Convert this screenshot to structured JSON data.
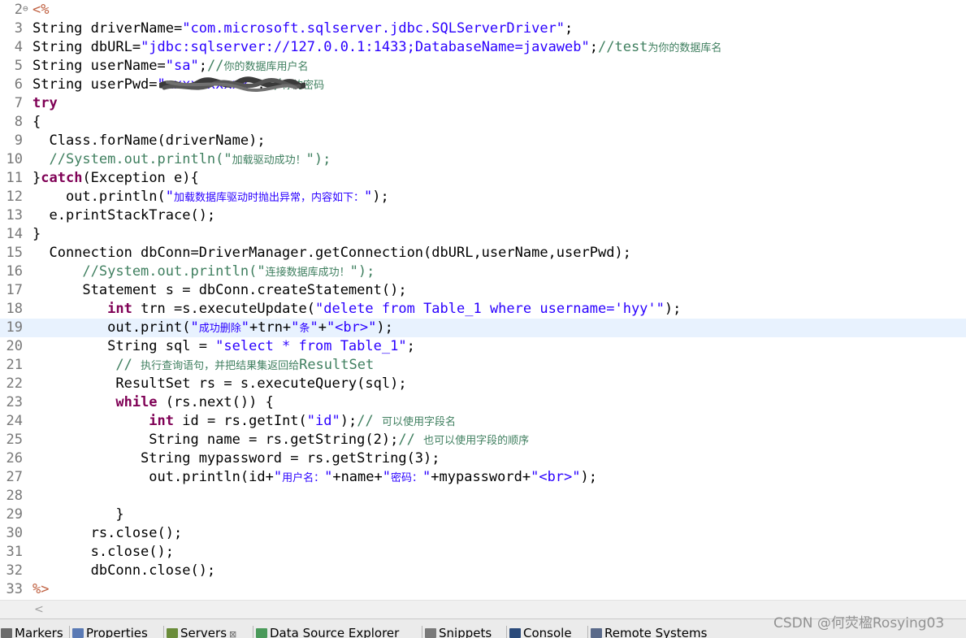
{
  "editor": {
    "lines": [
      {
        "n": "2",
        "fold": "⊖",
        "parts": [
          [
            "jsp",
            "<%"
          ]
        ]
      },
      {
        "n": "3",
        "parts": [
          [
            "",
            "String driverName="
          ],
          [
            "str",
            "\"com.microsoft.sqlserver.jdbc.SQLServerDriver\""
          ],
          [
            "",
            ";"
          ]
        ]
      },
      {
        "n": "4",
        "parts": [
          [
            "",
            "String dbURL="
          ],
          [
            "str",
            "\"jdbc:sqlserver://127.0.0.1:1433;DatabaseName=javaweb\""
          ],
          [
            "",
            ";"
          ],
          [
            "cm",
            "//test"
          ],
          [
            "cm cn",
            "为你的数据库名"
          ]
        ]
      },
      {
        "n": "5",
        "parts": [
          [
            "",
            "String userName="
          ],
          [
            "str",
            "\"sa\""
          ],
          [
            "",
            ";"
          ],
          [
            "cm",
            "//"
          ],
          [
            "cm cn",
            "你的数据库用户名"
          ]
        ]
      },
      {
        "n": "6",
        "parts": [
          [
            "",
            "String userPwd="
          ],
          [
            "str",
            "\"xxxxxxxxxx\""
          ],
          [
            "",
            ";"
          ],
          [
            "cm",
            "//"
          ],
          [
            "cm cn",
            "你的密码"
          ]
        ]
      },
      {
        "n": "7",
        "parts": [
          [
            "kw",
            "try"
          ]
        ]
      },
      {
        "n": "8",
        "parts": [
          [
            "",
            "{"
          ]
        ]
      },
      {
        "n": "9",
        "parts": [
          [
            "",
            "  Class.forName(driverName);"
          ]
        ]
      },
      {
        "n": "10",
        "parts": [
          [
            "cm",
            "  //System.out.println(\""
          ],
          [
            "cm cn",
            "加载驱动成功！"
          ],
          [
            "cm",
            "\");"
          ]
        ]
      },
      {
        "n": "11",
        "parts": [
          [
            "",
            "}"
          ],
          [
            "kw",
            "catch"
          ],
          [
            "",
            "(Exception e){"
          ]
        ]
      },
      {
        "n": "12",
        "parts": [
          [
            "",
            "    out.println("
          ],
          [
            "str",
            "\""
          ],
          [
            "str cn",
            "加载数据库驱动时抛出异常，内容如下："
          ],
          [
            "str",
            "\""
          ],
          [
            "",
            ");"
          ]
        ]
      },
      {
        "n": "13",
        "parts": [
          [
            "",
            "  e.printStackTrace();"
          ]
        ]
      },
      {
        "n": "14",
        "parts": [
          [
            "",
            "}"
          ]
        ]
      },
      {
        "n": "15",
        "parts": [
          [
            "",
            "  Connection dbConn=DriverManager.getConnection(dbURL,userName,userPwd);"
          ]
        ]
      },
      {
        "n": "16",
        "parts": [
          [
            "cm",
            "      //System.out.println(\""
          ],
          [
            "cm cn",
            "连接数据库成功！"
          ],
          [
            "cm",
            "\");"
          ]
        ]
      },
      {
        "n": "17",
        "parts": [
          [
            "",
            "      Statement s = dbConn.createStatement();"
          ]
        ]
      },
      {
        "n": "18",
        "parts": [
          [
            "",
            "         "
          ],
          [
            "kw",
            "int"
          ],
          [
            "",
            " trn =s.executeUpdate("
          ],
          [
            "str",
            "\"delete from Table_1 where username='hyy'\""
          ],
          [
            "",
            ");"
          ]
        ]
      },
      {
        "n": "19",
        "current": true,
        "parts": [
          [
            "",
            "         out.print("
          ],
          [
            "str",
            "\""
          ],
          [
            "str cn",
            "成功删除"
          ],
          [
            "str",
            "\""
          ],
          [
            "",
            "+trn+"
          ],
          [
            "str",
            "\""
          ],
          [
            "str cn",
            "条"
          ],
          [
            "str",
            "\""
          ],
          [
            "",
            "+"
          ],
          [
            "str",
            "\"<br>\""
          ],
          [
            "",
            ");"
          ]
        ]
      },
      {
        "n": "20",
        "parts": [
          [
            "",
            "         String sql = "
          ],
          [
            "str",
            "\"select * from Table_1\""
          ],
          [
            "",
            ";"
          ]
        ]
      },
      {
        "n": "21",
        "parts": [
          [
            "cm",
            "          // "
          ],
          [
            "cm cn",
            "执行查询语句，并把结果集返回给"
          ],
          [
            "cm",
            "ResultSet"
          ]
        ]
      },
      {
        "n": "22",
        "parts": [
          [
            "",
            "          ResultSet rs = s.executeQuery(sql);"
          ]
        ]
      },
      {
        "n": "23",
        "parts": [
          [
            "",
            "          "
          ],
          [
            "kw",
            "while"
          ],
          [
            "",
            " (rs.next()) {"
          ]
        ]
      },
      {
        "n": "24",
        "parts": [
          [
            "",
            "              "
          ],
          [
            "kw",
            "int"
          ],
          [
            "",
            " id = rs.getInt("
          ],
          [
            "str",
            "\"id\""
          ],
          [
            "",
            ");"
          ],
          [
            "cm",
            "// "
          ],
          [
            "cm cn",
            "可以使用字段名"
          ]
        ]
      },
      {
        "n": "25",
        "parts": [
          [
            "",
            "              String name = rs.getString(2);"
          ],
          [
            "cm",
            "// "
          ],
          [
            "cm cn",
            "也可以使用字段的顺序"
          ]
        ]
      },
      {
        "n": "26",
        "parts": [
          [
            "",
            "             String mypassword = rs.getString(3);"
          ]
        ]
      },
      {
        "n": "27",
        "parts": [
          [
            "",
            "              out.println(id+"
          ],
          [
            "str",
            "\""
          ],
          [
            "str cn",
            "用户名："
          ],
          [
            "str",
            "\""
          ],
          [
            "",
            "+name+"
          ],
          [
            "str",
            "\""
          ],
          [
            "str cn",
            "密码："
          ],
          [
            "str",
            "\""
          ],
          [
            "",
            "+mypassword+"
          ],
          [
            "str",
            "\"<br>\""
          ],
          [
            "",
            ");"
          ]
        ]
      },
      {
        "n": "28",
        "parts": []
      },
      {
        "n": "29",
        "parts": [
          [
            "",
            "          }"
          ]
        ]
      },
      {
        "n": "30",
        "parts": [
          [
            "",
            "       rs.close();"
          ]
        ]
      },
      {
        "n": "31",
        "parts": [
          [
            "",
            "       s.close();"
          ]
        ]
      },
      {
        "n": "32",
        "parts": [
          [
            "",
            "       dbConn.close();"
          ]
        ]
      },
      {
        "n": "33",
        "parts": [
          [
            "jsp",
            "%>"
          ]
        ]
      }
    ]
  },
  "scrollbar": {
    "left_arrow": "<"
  },
  "tabs": [
    {
      "label": "Markers",
      "icon": "markers-icon",
      "color": "#6b6b6b"
    },
    {
      "label": "Properties",
      "icon": "properties-icon",
      "color": "#5a7ab5"
    },
    {
      "label": "Servers",
      "icon": "servers-icon",
      "color": "#6a8c3a",
      "close": "⊠"
    },
    {
      "label": "Data Source Explorer",
      "icon": "data-source-icon",
      "color": "#4a9a5a"
    },
    {
      "label": "Snippets",
      "icon": "snippets-icon",
      "color": "#7a7a7a"
    },
    {
      "label": "Console",
      "icon": "console-icon",
      "color": "#2a4a7a"
    },
    {
      "label": "Remote Systems",
      "icon": "remote-systems-icon",
      "color": "#5a6a8a"
    }
  ],
  "watermark": "CSDN @何荧楹Rosying03",
  "colors": {
    "keyword": "#7f0055",
    "string": "#2a00ff",
    "comment": "#3f7f5f",
    "jsp_delimiter": "#bf5f3f",
    "current_line": "#e8f2fe"
  }
}
